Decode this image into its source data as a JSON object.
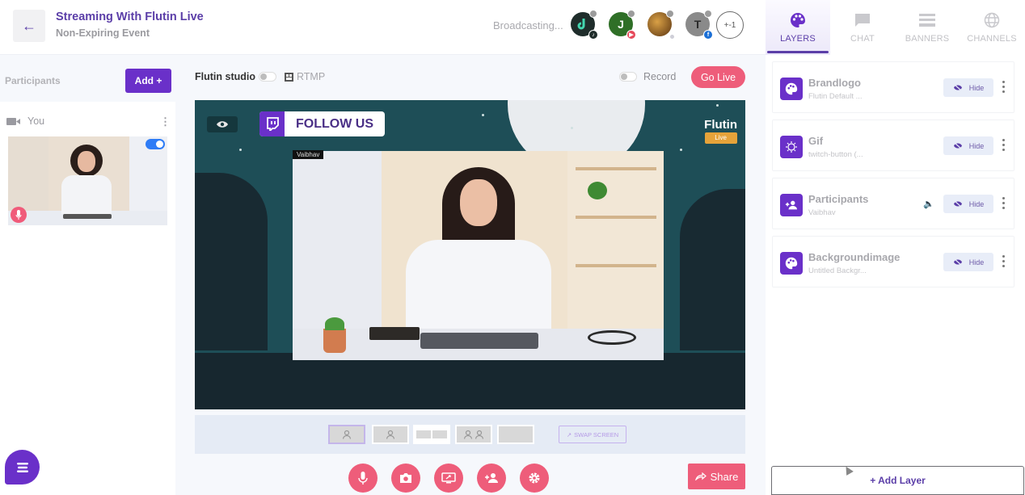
{
  "header": {
    "back_icon": "arrow-left-icon",
    "title": "Streaming With Flutin Live",
    "subtitle": "Non-Expiring Event",
    "status": "Broadcasting...",
    "destinations": [
      {
        "initial": "",
        "color": "#1f2d2b",
        "badge": "tiktok-icon",
        "badge_color": "#1f2d2b"
      },
      {
        "initial": "J",
        "color": "#2f6f27",
        "badge": "youtube-icon",
        "badge_color": "#e64a5b"
      },
      {
        "initial": "",
        "color": "#8b5a1f",
        "badge": "generic-icon",
        "badge_color": "#cccccc"
      },
      {
        "initial": "T",
        "color": "#8a8a8a",
        "badge": "facebook-icon",
        "badge_color": "#1b6fd6"
      }
    ],
    "more_count": "+-1"
  },
  "right_tabs": [
    {
      "label": "LAYERS",
      "icon": "palette-icon",
      "active": true
    },
    {
      "label": "CHAT",
      "icon": "chat-icon",
      "active": false
    },
    {
      "label": "BANNERS",
      "icon": "banners-icon",
      "active": false
    },
    {
      "label": "CHANNELS",
      "icon": "globe-icon",
      "active": false
    }
  ],
  "participants": {
    "label": "Participants",
    "add_label": "Add +",
    "items": [
      {
        "name": "You",
        "video_on": true
      }
    ]
  },
  "studio": {
    "studio_label": "Flutin studio",
    "rtmp_label": "RTMP",
    "record_label": "Record",
    "go_live_label": "Go Live"
  },
  "stage": {
    "follow_text": "FOLLOW US",
    "brand_name": "Flutin",
    "brand_badge": "Live",
    "participant_name": "Vaibhav"
  },
  "layout_bar": {
    "swap_label": "SWAP SCREEN"
  },
  "controls": [
    {
      "name": "mic-button",
      "icon": "mic-icon"
    },
    {
      "name": "camera-button",
      "icon": "camera-icon"
    },
    {
      "name": "screen-share-button",
      "icon": "screen-icon"
    },
    {
      "name": "invite-button",
      "icon": "add-person-icon"
    },
    {
      "name": "settings-button",
      "icon": "gear-icon"
    }
  ],
  "share_label": "Share",
  "layers": [
    {
      "name": "Brandlogo",
      "sub": "Flutin Default ...",
      "icon": "palette-icon",
      "hide_label": "Hide"
    },
    {
      "name": "Gif",
      "sub": "twitch-button (...",
      "icon": "gif-icon",
      "hide_label": "Hide"
    },
    {
      "name": "Participants",
      "sub": "Vaibhav",
      "icon": "participants-icon",
      "hide_label": "Hide"
    },
    {
      "name": "Backgroundimage",
      "sub": "Untitled Backgr...",
      "icon": "palette-icon",
      "hide_label": "Hide"
    }
  ],
  "add_layer_label": "+ Add Layer",
  "colors": {
    "brand_purple": "#6a30c9",
    "accent_pink": "#ee5d7a"
  }
}
